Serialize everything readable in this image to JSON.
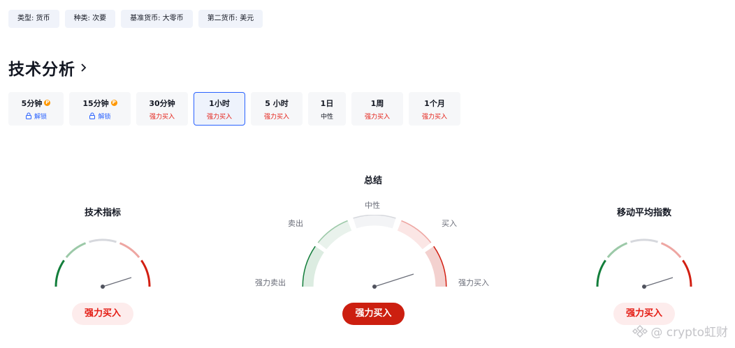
{
  "tags": [
    {
      "label": "类型: 货币"
    },
    {
      "label": "种类: 次要"
    },
    {
      "label": "基准货币: 大零币"
    },
    {
      "label": "第二货币: 美元"
    }
  ],
  "section_title": "技术分析",
  "tabs": [
    {
      "label": "5分钟",
      "sub": "解锁",
      "locked": true
    },
    {
      "label": "15分钟",
      "sub": "解锁",
      "locked": true
    },
    {
      "label": "30分钟",
      "sub": "强力买入"
    },
    {
      "label": "1小时",
      "sub": "强力买入",
      "active": true
    },
    {
      "label": "5 小时",
      "sub": "强力买入"
    },
    {
      "label": "1日",
      "sub": "中性"
    },
    {
      "label": "1周",
      "sub": "强力买入"
    },
    {
      "label": "1个月",
      "sub": "强力买入"
    }
  ],
  "gauges": {
    "oscillators": {
      "title": "技术指标",
      "result": "强力买入"
    },
    "summary": {
      "title": "总结",
      "result": "强力买入",
      "labels": {
        "strong_sell": "强力卖出",
        "sell": "卖出",
        "neutral": "中性",
        "buy": "买入",
        "strong_buy": "强力买入"
      }
    },
    "moving_averages": {
      "title": "移动平均指数",
      "result": "强力买入"
    }
  },
  "watermark": "@ crypto虹财",
  "colors": {
    "buy": "#e41b12",
    "sell": "#137e3b",
    "accent": "#2962ff"
  }
}
